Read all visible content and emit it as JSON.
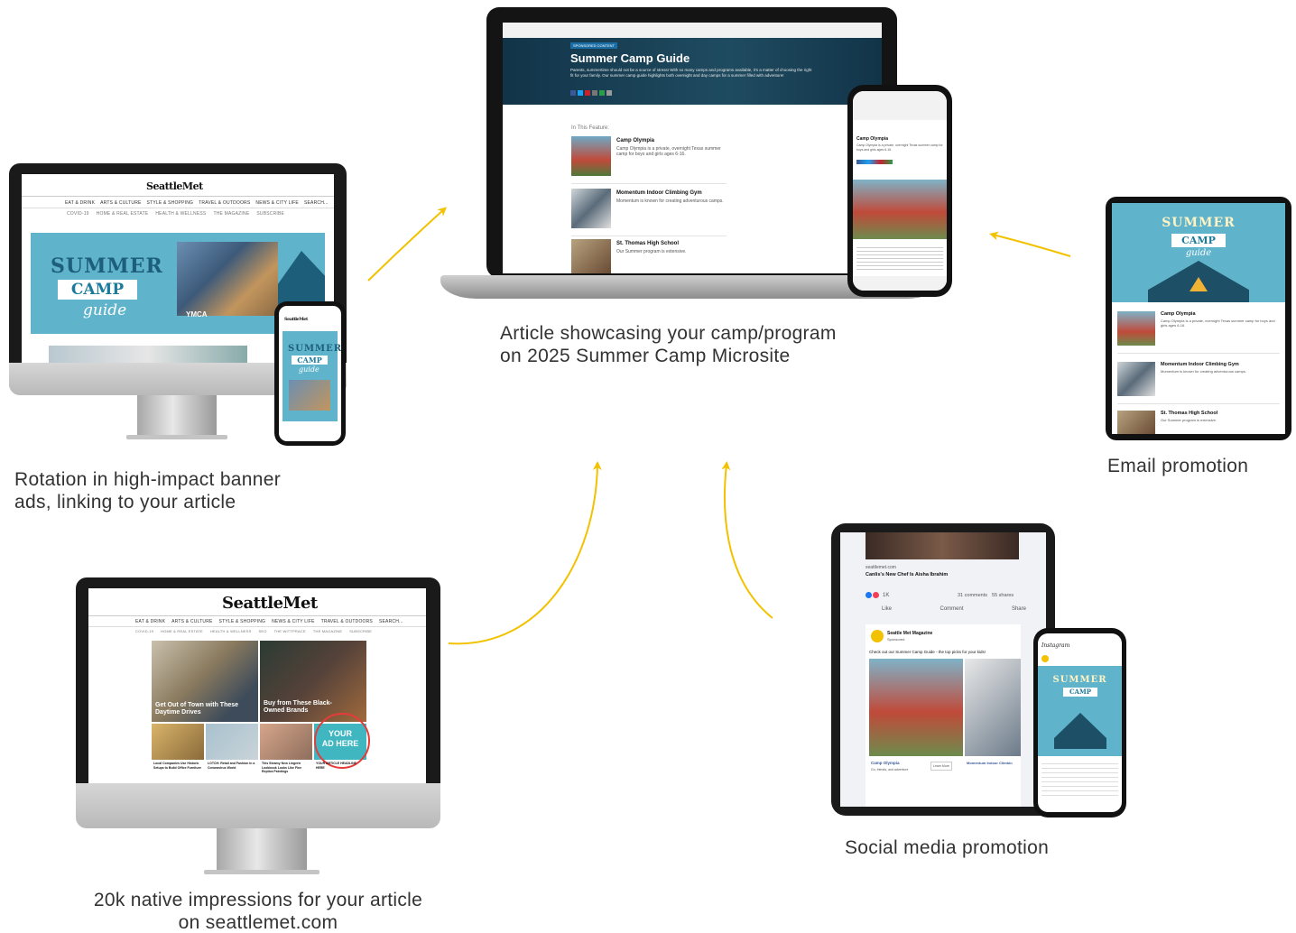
{
  "captions": {
    "banner": [
      "Rotation in high-impact banner",
      "ads, linking to your article"
    ],
    "microsite": [
      "Article showcasing your camp/program",
      "on 2025 Summer Camp Microsite"
    ],
    "email": "Email promotion",
    "native": [
      "20k native impressions for your article",
      "on seattlemet.com"
    ],
    "social": "Social media promotion"
  },
  "site": {
    "logo": "SeattleMet",
    "search": "SEARCH...",
    "nav": [
      "EAT & DRINK",
      "ARTS & CULTURE",
      "STYLE & SHOPPING",
      "NEWS & CITY LIFE",
      "TRAVEL & OUTDOORS"
    ],
    "subnav": [
      "COVID-19",
      "HOME & REAL ESTATE",
      "HEALTH & WELLNESS",
      "SEO",
      "THE WITTPRACE",
      "THE MAGAZINE",
      "SUBSCRIBE"
    ]
  },
  "banner_ad": {
    "summer": "SUMMER",
    "camp": "CAMP",
    "guide": "guide",
    "ymca": "YMCA"
  },
  "microsite": {
    "badge": "SPONSORED CONTENT",
    "title": "Summer Camp Guide",
    "intro": "Parents, summertime should not be a source of stress! With so many camps and programs available, it's a matter of choosing the right fit for your family. Our summer camp guide highlights both overnight and day camps for a summer filled with adventure!",
    "feature_label": "In This Feature:",
    "articles": [
      {
        "title": "Camp Olympia",
        "desc": "Camp Olympia is a private, overnight Texas summer camp for boys and girls ages 6-16."
      },
      {
        "title": "Momentum Indoor Climbing Gym",
        "desc": "Momentum is known for creating adventurous camps."
      },
      {
        "title": "St. Thomas High School",
        "desc": "Our Summer program is extensive."
      }
    ]
  },
  "email": {
    "summer": "SUMMER",
    "camp": "CAMP",
    "guide": "guide",
    "items": [
      {
        "title": "Camp Olympia",
        "desc": "Camp Olympia is a private, overnight Texas summer camp for boys and girls ages 6-16."
      },
      {
        "title": "Momentum Indoor Climbing Gym",
        "desc": "Momentum is known for creating adventurous camps."
      },
      {
        "title": "St. Thomas High School",
        "desc": "Our Summer program is extensive."
      }
    ]
  },
  "native": {
    "story1": "Get Out of Town with These Daytime Drives",
    "story2": "Buy from These Black-Owned Brands",
    "ad": [
      "YOUR",
      "AD HERE"
    ],
    "headline": "YOUR ARTICLE HEADLINE HERE",
    "small_stories": [
      "Local Companies Use Historic Setups to Build Office Furniture",
      "LOTCH: Retail and Fashion in a Coronavirus World",
      "This Steamy New Lingerie Lookbook Looks Like Fine Replica Paintings"
    ]
  },
  "social": {
    "source": "seattlemet.com",
    "headline": "Canlis's New Chef Is Aisha Ibrahim",
    "reactions": "1K",
    "comments": "31 comments",
    "shares": "55 shares",
    "like": "Like",
    "comment": "Comment",
    "share": "Share",
    "page": "Seattle Met Magazine",
    "sponsored": "Sponsored",
    "post_text": "Check out our Summer Camp Guide - the top picks for your kids!",
    "card1": "Camp Olympia",
    "card1_sub": "Go, friends, and adventure",
    "card2": "Momentum Indoor Climbin",
    "learn_more": "Learn More",
    "instagram": "Instagram",
    "ig_summer": "SUMMER",
    "ig_camp": "CAMP"
  }
}
